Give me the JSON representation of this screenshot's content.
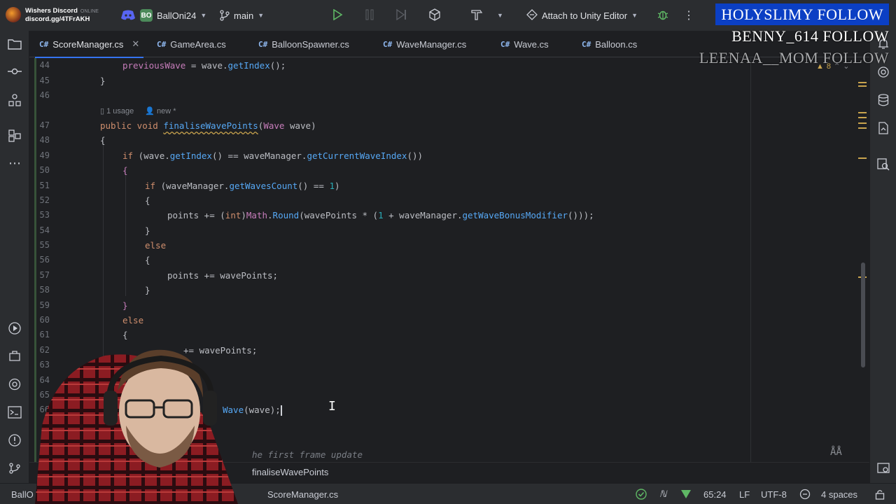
{
  "titlebar": {
    "project_badge": "BO",
    "project_name": "BallOni24",
    "branch": "main",
    "attach_label": "Attach to Unity Editor"
  },
  "discord_overlay": {
    "server_name": "Wishers Discord",
    "invite": "discord.gg/4TFrAKH",
    "status": "ONLINE"
  },
  "follow_alerts": [
    "HOLYSLIMY  FOLLOW",
    "BENNY_614  FOLLOW",
    "LEENAA__MOM  FOLLOW"
  ],
  "tabs": [
    {
      "icon": "C#",
      "label": "ScoreManager.cs",
      "active": true
    },
    {
      "icon": "C#",
      "label": "GameArea.cs"
    },
    {
      "icon": "C#",
      "label": "BalloonSpawner.cs"
    },
    {
      "icon": "C#",
      "label": "WaveManager.cs"
    },
    {
      "icon": "C#",
      "label": "Wave.cs"
    },
    {
      "icon": "C#",
      "label": "Balloon.cs"
    }
  ],
  "editor": {
    "line_numbers": [
      "44",
      "45",
      "46",
      "47",
      "48",
      "49",
      "50",
      "51",
      "52",
      "53",
      "54",
      "55",
      "56",
      "57",
      "58",
      "59",
      "60",
      "61",
      "62",
      "63",
      "64",
      "65",
      "66"
    ],
    "usage_hint": "1 usage",
    "new_hint": "new *",
    "warning_count": "8",
    "code": {
      "l44": "previousWave = wave.getIndex();",
      "l45": "}",
      "l47_kw": "public void",
      "l47_fn": "finaliseWavePoints",
      "l47_type": "Wave",
      "l47_param": "wave)",
      "l48": "{",
      "l49_kw": "if",
      "l49_a": "(wave.",
      "l49_f1": "getIndex",
      "l49_b": "() == waveManager.",
      "l49_f2": "getCurrentWaveIndex",
      "l49_c": "())",
      "l50": "{",
      "l51_kw": "if",
      "l51_a": "(waveManager.",
      "l51_f": "getWavesCount",
      "l51_b": "() == ",
      "l51_num": "1",
      "l51_c": ")",
      "l52": "{",
      "l53_a": "points += (",
      "l53_kw": "int",
      "l53_b": ")",
      "l53_cls": "Math",
      "l53_c": ".",
      "l53_f": "Round",
      "l53_d": "(wavePoints * (",
      "l53_num": "1",
      "l53_e": " + waveManager.",
      "l53_f2": "getWaveBonusModifier",
      "l53_g": "()));",
      "l54": "}",
      "l55": "else",
      "l56": "{",
      "l57": "points += wavePoints;",
      "l58": "}",
      "l59": "}",
      "l60": "else",
      "l61": "{",
      "l62": "+= wavePoints;",
      "l66_fn": "Wave",
      "l66_rest": "(wave);",
      "comment_fragment": "he first frame update"
    }
  },
  "breadcrumb": {
    "method": "finaliseWavePoints"
  },
  "statusbar": {
    "project": "BallO",
    "file": "ScoreManager.cs",
    "position": "65:24",
    "line_ending": "LF",
    "encoding": "UTF-8",
    "indent": "4 spaces"
  },
  "colors": {
    "accent": "#3574f0",
    "editor_bg": "#1e1f22",
    "panel_bg": "#2b2d30",
    "keyword": "#cf8e6d",
    "function": "#56a8f5",
    "follow_highlight": "#0b3fc4"
  }
}
